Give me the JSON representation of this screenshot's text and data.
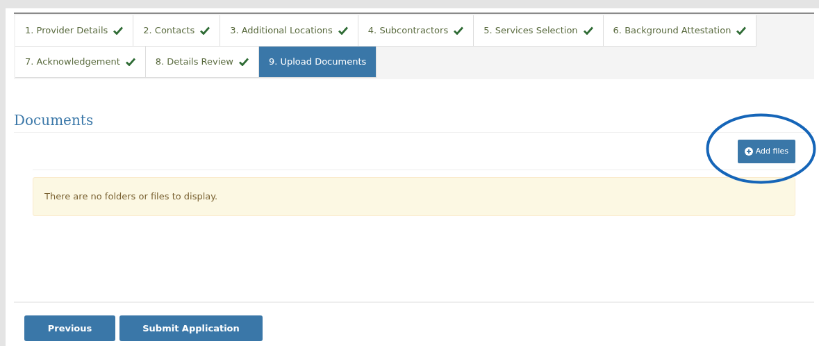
{
  "tab_rows": [
    [
      {
        "label": "1. Provider Details",
        "completed": true,
        "selected": false
      },
      {
        "label": "2. Contacts",
        "completed": true,
        "selected": false
      },
      {
        "label": "3. Additional Locations",
        "completed": true,
        "selected": false
      },
      {
        "label": "4. Subcontractors",
        "completed": true,
        "selected": false
      },
      {
        "label": "5. Services Selection",
        "completed": true,
        "selected": false
      },
      {
        "label": "6. Background Attestation",
        "completed": true,
        "selected": false
      }
    ],
    [
      {
        "label": "7. Acknowledgement",
        "completed": true,
        "selected": false
      },
      {
        "label": "8. Details Review",
        "completed": true,
        "selected": false
      },
      {
        "label": "9. Upload Documents",
        "completed": false,
        "selected": true
      }
    ]
  ],
  "section": {
    "title": "Documents",
    "add_button": "Add files",
    "empty_message": "There are no folders or files to display."
  },
  "footer_buttons": [
    "Previous",
    "Submit Application"
  ]
}
